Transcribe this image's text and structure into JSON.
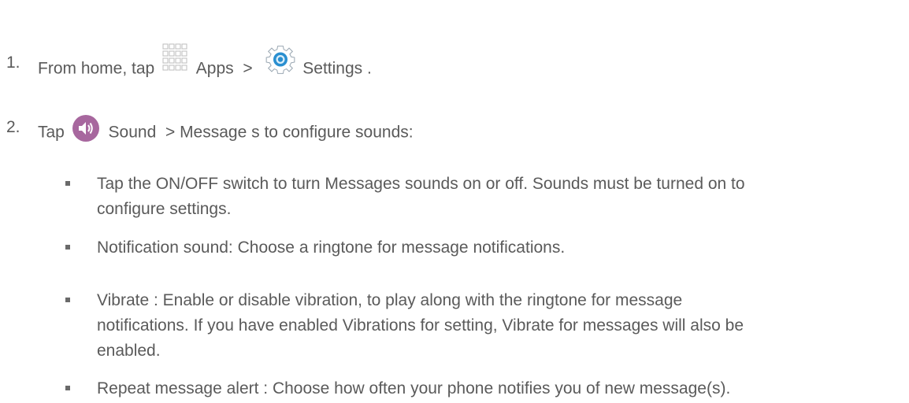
{
  "steps": [
    {
      "number": "1.",
      "intro": "From home, tap",
      "apps_label": "Apps",
      "sep": ">",
      "settings_label": "Settings",
      "end": "."
    },
    {
      "number": "2.",
      "intro": "Tap",
      "sound_label": "Sound",
      "sep": ">",
      "messages_label": "Message s",
      "rest": "to configure sounds:"
    }
  ],
  "bullets": [
    {
      "lines": [
        "Tap the ON/OFF switch to turn Messages sounds on or off. Sounds must be turned on to",
        "configure settings."
      ]
    },
    {
      "lines": [
        "Notification sound:    Choose a ringtone for message notifications."
      ]
    },
    {
      "lines": [
        "Vibrate :  Enable or disable vibration, to play along with the ringtone for message",
        "notifications. If you have enabled Vibrations for setting, Vibrate for messages will also be",
        "enabled."
      ]
    },
    {
      "lines": [
        "Repeat message alert  : Choose how often your phone notifies you of new message(s)."
      ]
    }
  ],
  "icons": {
    "apps": "apps-grid-icon",
    "settings": "gear-icon",
    "sound": "speaker-icon"
  },
  "colors": {
    "text": "#5a5a5a",
    "sound_icon": "#a7679e",
    "gear_blue": "#2a8fd0"
  }
}
